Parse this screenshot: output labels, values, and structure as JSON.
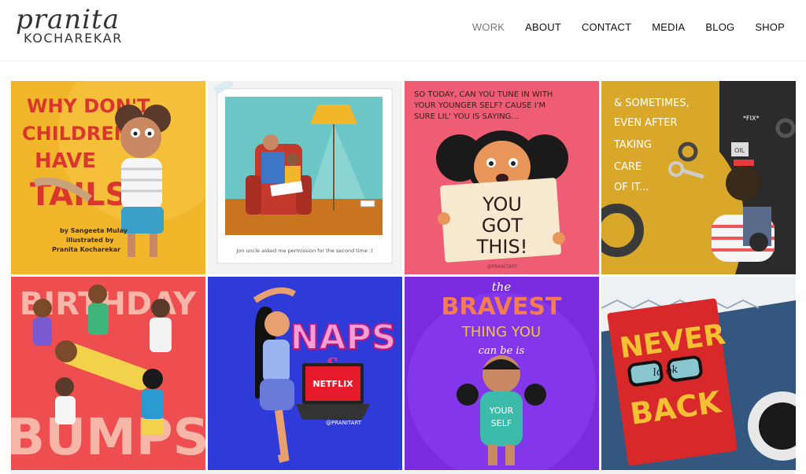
{
  "brand": {
    "script": "pranita",
    "name": "KOCHAREKAR"
  },
  "nav": [
    {
      "label": "WORK",
      "active": true
    },
    {
      "label": "ABOUT"
    },
    {
      "label": "CONTACT"
    },
    {
      "label": "MEDIA"
    },
    {
      "label": "BLOG"
    },
    {
      "label": "SHOP"
    }
  ],
  "tiles": {
    "t1": {
      "line1": "WHY DON'T",
      "line2": "CHILDREN",
      "line3": "HAVE",
      "line4": "TAILS?",
      "by": "by Sangeeta Mulay",
      "ill": "illustrated by",
      "author": "Pranita Kocharekar"
    },
    "t2": {
      "caption": "Jon uncle asked me permission for the second time :)"
    },
    "t3": {
      "top1": "SO TODAY, CAN YOU TUNE IN WITH",
      "top2": "YOUR YOUNGER SELF? CAUSE I'M",
      "top3": "SURE LIL' YOU IS SAYING...",
      "sign1": "YOU",
      "sign2": "GOT",
      "sign3": "THIS!",
      "handle": "@PRANITART"
    },
    "t4": {
      "l1": "& SOMETIMES,",
      "l2": "EVEN AFTER",
      "l3": "TAKING",
      "l4": "CARE",
      "l5": "OF IT...",
      "fix": "*FIX*",
      "oil": "OIL"
    },
    "t5": {
      "top": "BIRTHDAY",
      "bottom": "BUMPS"
    },
    "t6": {
      "naps": "NAPS",
      "amp": "&",
      "netflix": "NETFLIX",
      "handle": "@PRANITART"
    },
    "t7": {
      "the": "the",
      "bravest": "BRAVEST",
      "thing": "THING YOU",
      "canbe": "can be is",
      "your": "YOUR",
      "self": "SELF"
    },
    "t8": {
      "never": "NEVER",
      "look": "lo  ok",
      "back": "BACK"
    }
  },
  "colors": {
    "yellow": "#f2b62b",
    "teal": "#6dc6c6",
    "pink": "#ee5d73",
    "mustard": "#d9a82a",
    "coral": "#ef4e50",
    "blue": "#2f3bd9",
    "purple": "#7a2be0",
    "denim": "#33577f"
  }
}
